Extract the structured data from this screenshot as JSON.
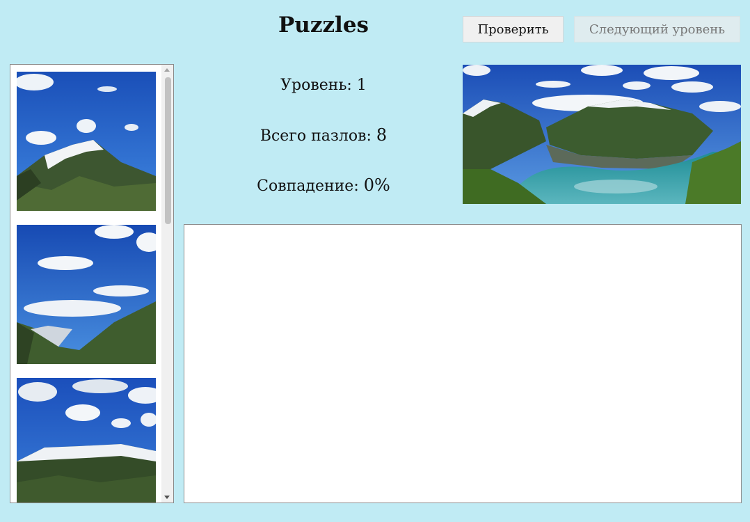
{
  "header": {
    "title": "Puzzles",
    "check_label": "Проверить",
    "next_label": "Следующий уровень"
  },
  "stats": {
    "level_label": "Уровень:",
    "level_value": "1",
    "total_label": "Всего пазлов:",
    "total_value": "8",
    "match_label": "Совпадение:",
    "match_value": "0%"
  },
  "pieces_count_visible": 3,
  "colors": {
    "background": "#c0ebf4",
    "sky": "#1f5fc4",
    "water": "#2a9aa3",
    "mountain": "#3b5a2e"
  }
}
